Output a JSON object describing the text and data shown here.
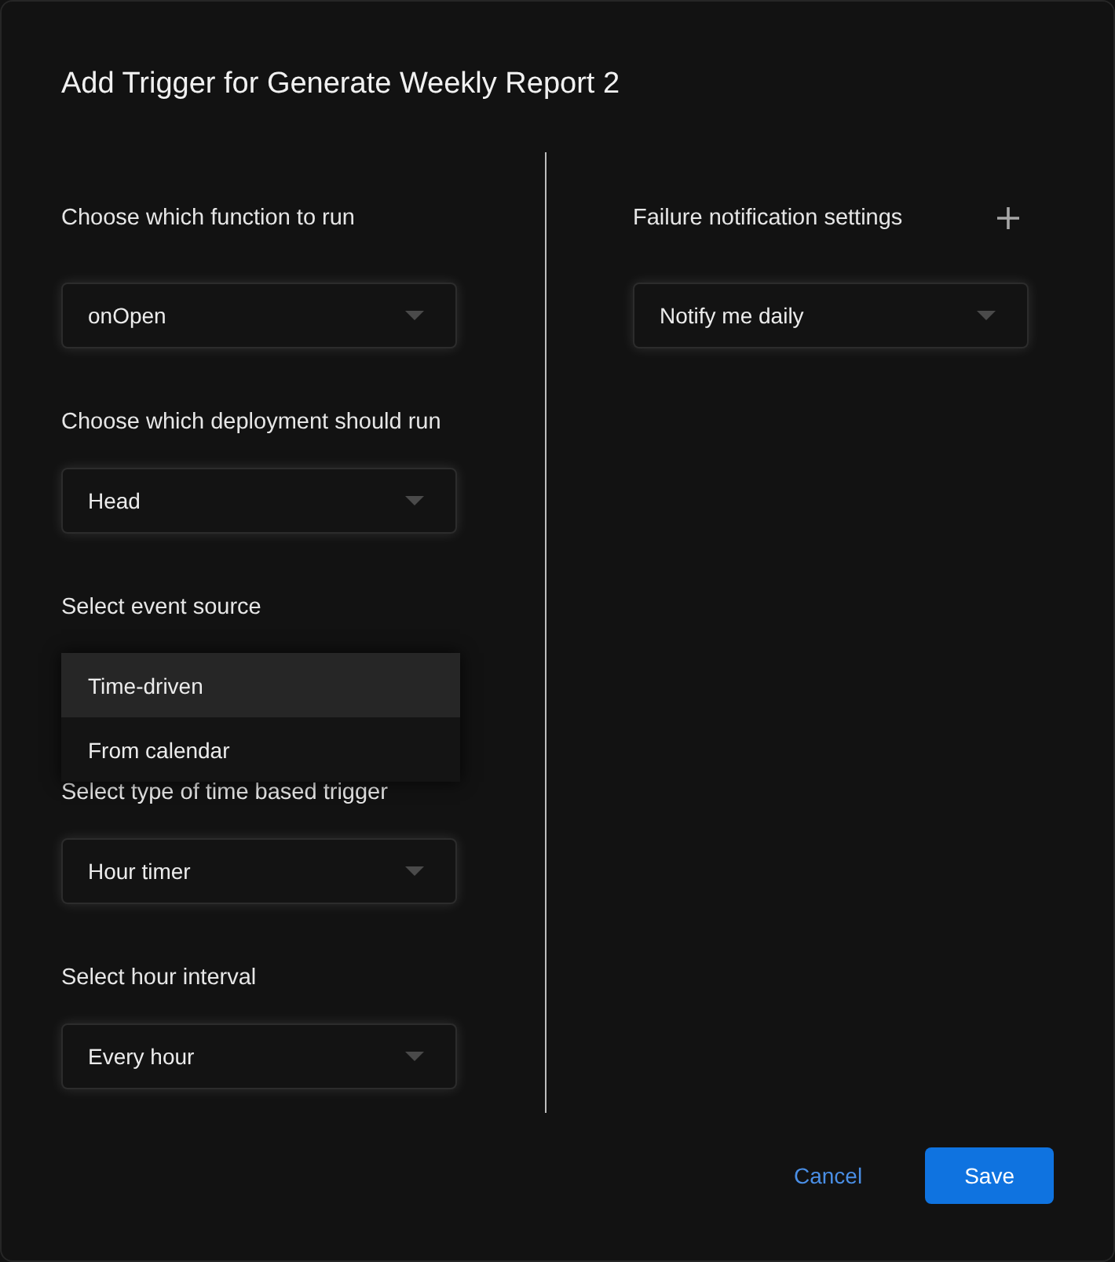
{
  "dialog": {
    "title": "Add Trigger for Generate Weekly Report 2"
  },
  "fields": [
    {
      "label": "Choose which function to run",
      "value": "onOpen",
      "expanded": false
    },
    {
      "label": "Choose which deployment should run",
      "value": "Head",
      "expanded": false
    },
    {
      "label": "Select event source",
      "expanded": true,
      "options": [
        {
          "label": "Time-driven",
          "selected": true
        },
        {
          "label": "From calendar",
          "selected": false
        }
      ]
    },
    {
      "label": "Select type of time based trigger",
      "value": "Hour timer",
      "expanded": false
    },
    {
      "label": "Select hour interval",
      "value": "Every hour",
      "expanded": false
    }
  ],
  "failure_notification": {
    "label": "Failure notification settings",
    "value": "Notify me daily",
    "expanded": false
  },
  "buttons": [
    {
      "label": "Cancel",
      "kind": "text"
    },
    {
      "label": "Save",
      "kind": "primary"
    }
  ]
}
